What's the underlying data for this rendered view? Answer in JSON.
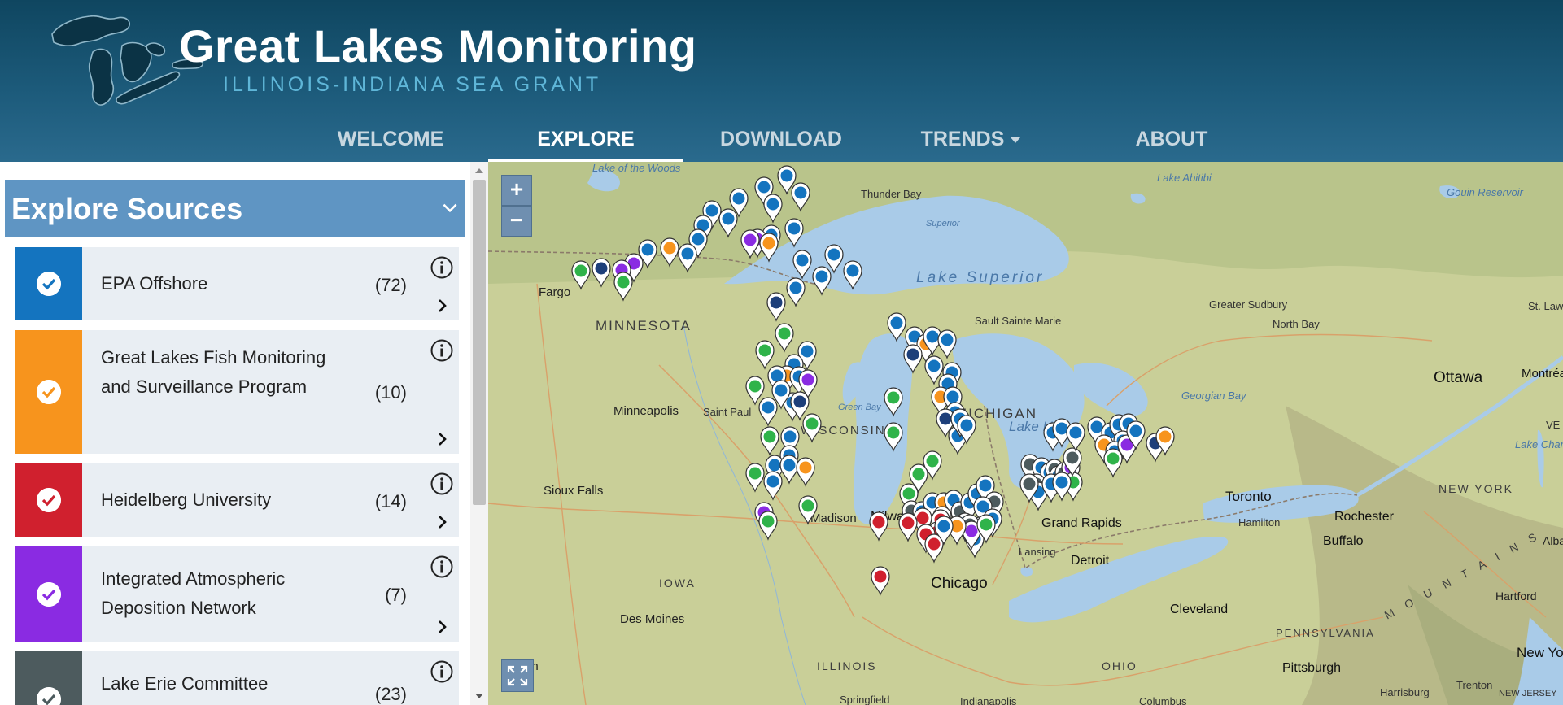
{
  "header": {
    "title": "Great Lakes Monitoring",
    "subtitle": "ILLINOIS-INDIANA SEA GRANT"
  },
  "nav": {
    "items": [
      {
        "label": "WELCOME",
        "active": false
      },
      {
        "label": "EXPLORE",
        "active": true
      },
      {
        "label": "DOWNLOAD",
        "active": false
      },
      {
        "label": "TRENDS",
        "active": false
      },
      {
        "label": "ABOUT",
        "active": false
      }
    ]
  },
  "sidebar": {
    "panel_title": "Explore Sources",
    "sources": [
      {
        "name": "EPA Offshore",
        "count": "(72)",
        "color": "#1474bf"
      },
      {
        "name": "Great Lakes Fish Monitoring and Surveillance Program",
        "count": "(10)",
        "color": "#f7941d"
      },
      {
        "name": "Heidelberg University",
        "count": "(14)",
        "color": "#d0202e"
      },
      {
        "name": "Integrated Atmospheric Deposition Network",
        "count": "(7)",
        "color": "#8a2be2"
      },
      {
        "name": "Lake Erie Committee",
        "count": "(23)",
        "color": "#4d5b5e"
      }
    ]
  },
  "map": {
    "zoom_in": "+",
    "zoom_out": "−",
    "labels": {
      "lake_of_woods": "Lake of the Woods",
      "thunder_bay": "Thunder Bay",
      "lake_superior": "Lake Superior",
      "superior_small": "Superior",
      "lake_abitibi": "Lake Abitibi",
      "gouin": "Gouin Reservoir",
      "fargo": "Fargo",
      "minnesota": "MINNESOTA",
      "sault": "Sault Sainte Marie",
      "greater_sudbury": "Greater Sudbury",
      "north_bay": "North Bay",
      "ottawa": "Ottawa",
      "montreal": "Montréal",
      "minneapolis": "Minneapolis",
      "saint_paul": "Saint Paul",
      "wisconsin": "WISCONSIN",
      "green_bay": "Green Bay",
      "michigan": "MICHIGAN",
      "lake_huron": "Lake Huron",
      "georgian_bay": "Georgian Bay",
      "lake_champlain": "Lake Champlain",
      "sioux_falls": "Sioux Falls",
      "toronto": "Toronto",
      "rochester": "Rochester",
      "new_york": "NEW YORK",
      "madison": "Madison",
      "milwaukee": "Milwaukee",
      "grand_rapids": "Grand Rapids",
      "hamilton": "Hamilton",
      "buffalo": "Buffalo",
      "albany": "Albany",
      "lansing": "Lansing",
      "detroit": "Detroit",
      "iowa": "IOWA",
      "chicago": "Chicago",
      "cleveland": "Cleveland",
      "hartford": "Hartford",
      "des_moines": "Des Moines",
      "pennsylvania": "PENNSYLVANIA",
      "illinois": "ILLINOIS",
      "ohio": "OHIO",
      "pittsburgh": "Pittsburgh",
      "harrisburg": "Harrisburg",
      "trenton": "Trenton",
      "new_jersey": "NEW JERSEY",
      "new_york_city": "New Yo",
      "mountains": "M O U N T A I N S",
      "vermont": "VE",
      "st_lawrence": "St. Lawrence",
      "lincoln": "ln",
      "springfield": "Springfield",
      "indianapolis": "Indianapolis",
      "columbus": "Columbus"
    }
  },
  "colors": {
    "header_dark": "#0f4660",
    "panel_blue": "#5f95c3",
    "epa_blue": "#1474bf",
    "fish_orange": "#f7941d",
    "heidelberg_red": "#d0202e",
    "iadn_purple": "#8a2be2",
    "lec_gray": "#4d5b5e",
    "glri_green": "#2fb34a",
    "navy": "#1d3f7a",
    "lake_water": "#a9cbe8"
  },
  "icons": {
    "check": "check-icon",
    "info": "info-icon",
    "chevron": "chevron-right-icon",
    "collapse": "chevron-down-icon",
    "fullscreen": "fullscreen-icon",
    "marker": "map-marker-icon"
  }
}
